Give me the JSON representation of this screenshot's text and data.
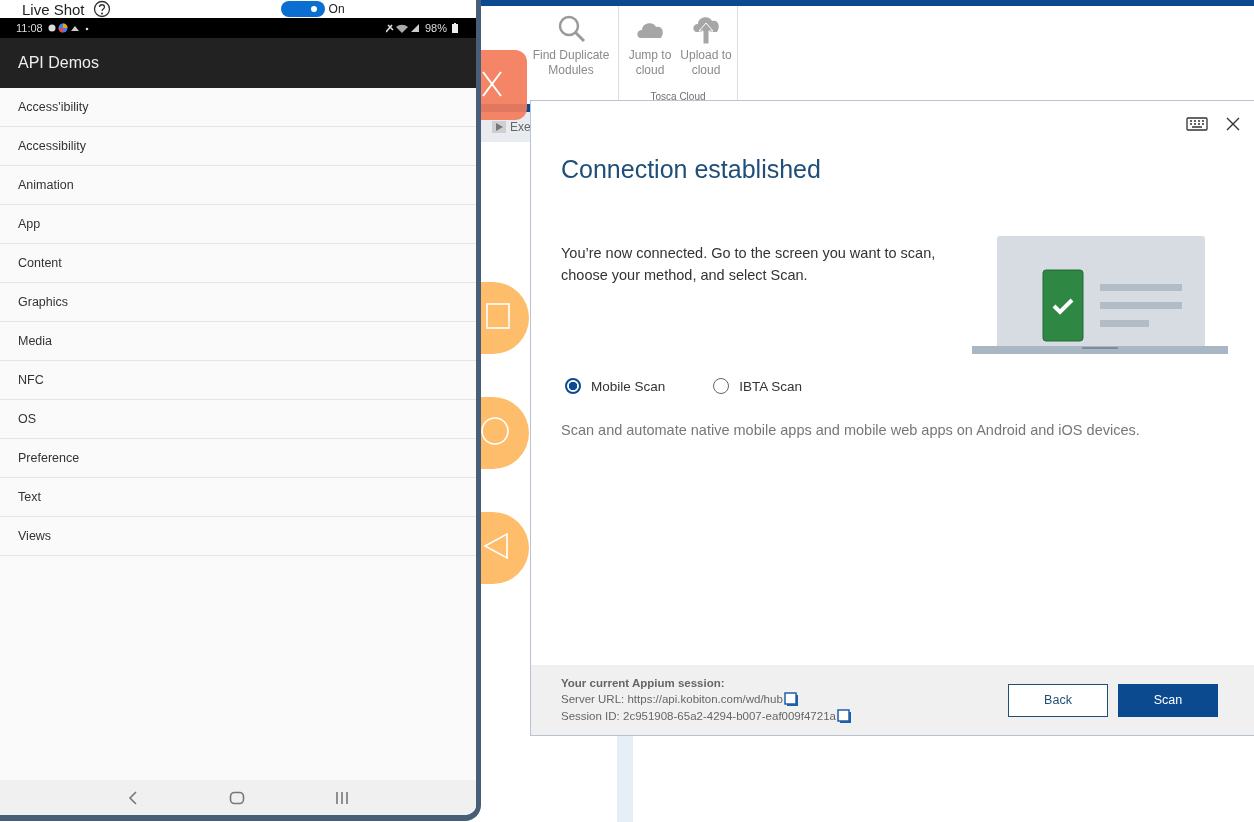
{
  "live_shot": {
    "label": "Live Shot",
    "toggle": {
      "on": true,
      "label": "On"
    }
  },
  "status_bar": {
    "time": "11:08",
    "battery": "98%"
  },
  "app_bar": {
    "title": "API Demos"
  },
  "list": [
    {
      "label": "Access'ibility"
    },
    {
      "label": "Accessibility"
    },
    {
      "label": "Animation"
    },
    {
      "label": "App"
    },
    {
      "label": "Content"
    },
    {
      "label": "Graphics"
    },
    {
      "label": "Media"
    },
    {
      "label": "NFC"
    },
    {
      "label": "OS"
    },
    {
      "label": "Preference"
    },
    {
      "label": "Text"
    },
    {
      "label": "Views"
    }
  ],
  "ribbon": {
    "buttons": [
      {
        "label": "Find Duplicate Modules",
        "kind": "search"
      },
      {
        "label": "Jump to cloud",
        "kind": "cloud"
      },
      {
        "label": "Upload to cloud",
        "kind": "upload"
      }
    ],
    "group_label": "Tosca Cloud",
    "tab_label": "Exe"
  },
  "dialog": {
    "title": "Connection established",
    "message": "You’re now connected. Go to the screen you want to scan, choose your method, and select Scan.",
    "scan_methods": [
      {
        "label": "Mobile Scan",
        "selected": true
      },
      {
        "label": "IBTA Scan",
        "selected": false
      }
    ],
    "description": "Scan and automate native mobile apps and mobile web apps on Android and iOS devices.",
    "session": {
      "heading": "Your current Appium session:",
      "server_url": "Server URL: https://api.kobiton.com/wd/hub",
      "session_id": "Session ID: 2c951908-65a2-4294-b007-eaf009f4721a"
    },
    "buttons": [
      {
        "label": "Back",
        "kind": "secondary"
      },
      {
        "label": "Scan",
        "kind": "primary"
      }
    ]
  }
}
